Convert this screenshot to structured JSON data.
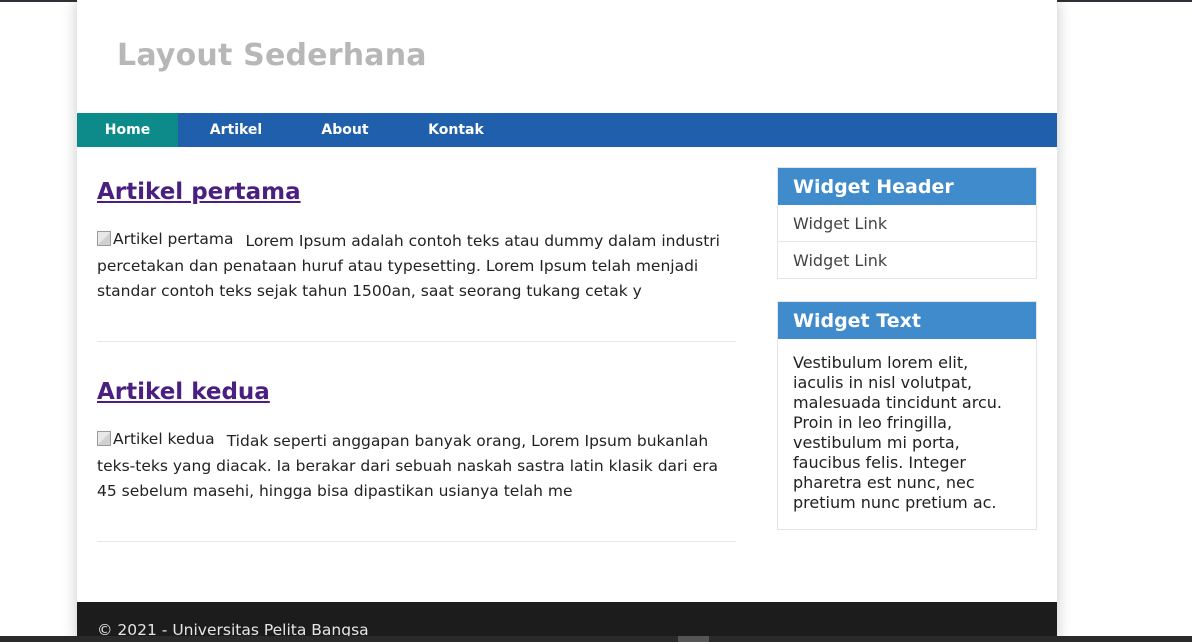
{
  "site": {
    "title": "Layout Sederhana"
  },
  "nav": {
    "items": [
      {
        "label": "Home",
        "active": true
      },
      {
        "label": "Artikel",
        "active": false
      },
      {
        "label": "About",
        "active": false
      },
      {
        "label": "Kontak",
        "active": false
      }
    ]
  },
  "articles": [
    {
      "title": "Artikel pertama",
      "image_alt": "Artikel pertama",
      "excerpt": "Lorem Ipsum adalah contoh teks atau dummy dalam industri percetakan dan penataan huruf atau typesetting. Lorem Ipsum telah menjadi standar contoh teks sejak tahun 1500an, saat seorang tukang cetak y"
    },
    {
      "title": "Artikel kedua",
      "image_alt": "Artikel kedua",
      "excerpt": "Tidak seperti anggapan banyak orang, Lorem Ipsum bukanlah teks-teks yang diacak. Ia berakar dari sebuah naskah sastra latin klasik dari era 45 sebelum masehi, hingga bisa dipastikan usianya telah me"
    }
  ],
  "sidebar": {
    "widget_links": {
      "header": "Widget Header",
      "links": [
        "Widget Link",
        "Widget Link"
      ]
    },
    "widget_text": {
      "header": "Widget Text",
      "body": "Vestibulum lorem elit, iaculis in nisl volutpat, malesuada tincidunt arcu. Proin in leo fringilla, vestibulum mi porta, faucibus felis. Integer pharetra est nunc, nec pretium nunc pretium ac."
    }
  },
  "footer": {
    "text": "© 2021 - Universitas Pelita Bangsa"
  },
  "colors": {
    "nav_background": "#205fab",
    "nav_active": "#0d8a8a",
    "widget_header": "#3f8bcc",
    "article_title": "#4b1f7f",
    "site_title": "#b7b7b7",
    "footer_background": "#1c1c1c"
  },
  "icons": {
    "article_image": "broken-image-icon"
  }
}
